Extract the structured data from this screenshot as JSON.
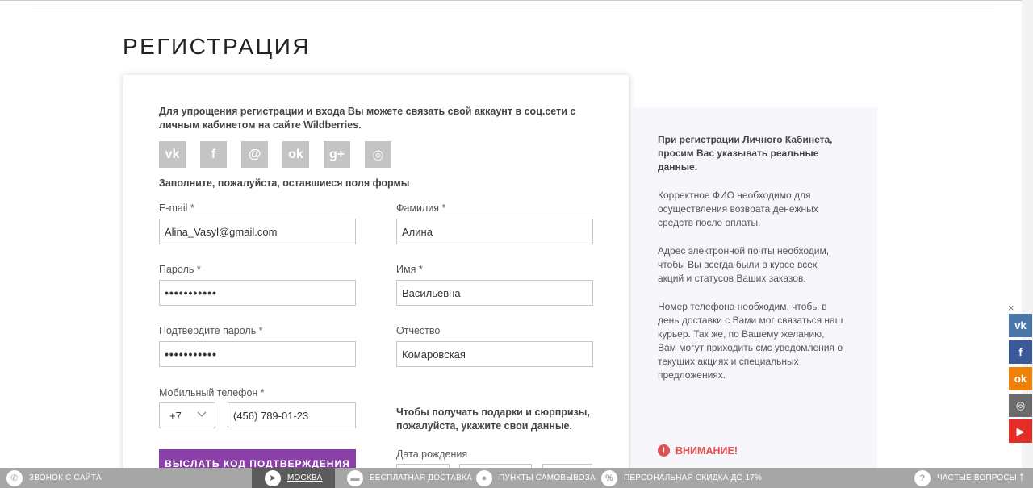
{
  "page": {
    "title": "РЕГИСТРАЦИЯ"
  },
  "form": {
    "intro": "Для упрощения регистрации и входа Вы можете связать свой аккаунт в соц.сети с личным кабинетом на сайте Wildberries.",
    "socials": [
      {
        "name": "vk-icon",
        "glyph": "vk"
      },
      {
        "name": "facebook-icon",
        "glyph": "f"
      },
      {
        "name": "mail-icon",
        "glyph": "@"
      },
      {
        "name": "odnoklassniki-icon",
        "glyph": "ok"
      },
      {
        "name": "google-plus-icon",
        "glyph": "g+"
      },
      {
        "name": "instagram-icon",
        "glyph": "◎"
      }
    ],
    "fill_hint": "Заполните, пожалуйста, оставшиеся поля формы",
    "email": {
      "label": "E-mail *",
      "value": "Alina_Vasyl@gmail.com"
    },
    "password": {
      "label": "Пароль *",
      "value": "•••••••••••"
    },
    "password_confirm": {
      "label": "Подтвердите пароль *",
      "value": "•••••••••••"
    },
    "phone": {
      "label": "Мобильный телефон *",
      "code": "+7",
      "value": "(456) 789-01-23"
    },
    "send_code_button": "ВЫСЛАТЬ КОД ПОДТВЕРЖДЕНИЯ",
    "last_name": {
      "label": "Фамилия *",
      "value": "Алина"
    },
    "first_name": {
      "label": "Имя *",
      "value": "Васильевна"
    },
    "patronymic": {
      "label": "Отчество",
      "value": "Комаровская"
    },
    "gift_hint": "Чтобы получать подарки и сюрпризы, пожалуйста, укажите свои данные.",
    "dob_label": "Дата рождения"
  },
  "info": {
    "p1": "При регистрации Личного Кабинета, просим Вас указывать реальные данные.",
    "p2": "Корректное ФИО необходимо для осуществления возврата денежных средств после оплаты.",
    "p3": "Адрес электронной почты необходим, чтобы Вы всегда были в курсе всех акций и статусов Ваших заказов.",
    "p4": "Номер телефона необходим, чтобы в день доставки с Вами мог связаться наш курьер. Так же, по Вашему желанию, Вам могут приходить смс уведомления о текущих акциях и специальных предложениях.",
    "warning": "ВНИМАНИЕ!"
  },
  "side_share": {
    "close": "×",
    "items": [
      {
        "name": "vk",
        "glyph": "vk",
        "color": "#4a76a8"
      },
      {
        "name": "facebook",
        "glyph": "f",
        "color": "#3b5998"
      },
      {
        "name": "odnoklassniki",
        "glyph": "ok",
        "color": "#ee8208"
      },
      {
        "name": "instagram",
        "glyph": "◎",
        "color": "#6b6b6b"
      },
      {
        "name": "youtube",
        "glyph": "▶",
        "color": "#e52d27"
      }
    ]
  },
  "bottom_bar": {
    "callback": "ЗВОНОК С САЙТА",
    "city": "МОСКВА",
    "delivery": "БЕСПЛАТНАЯ ДОСТАВКА",
    "pickup": "ПУНКТЫ САМОВЫВОЗА",
    "discount": "ПЕРСОНАЛЬНАЯ СКИДКА ДО 17%",
    "faq": "ЧАСТЫЕ ВОПРОСЫ"
  }
}
